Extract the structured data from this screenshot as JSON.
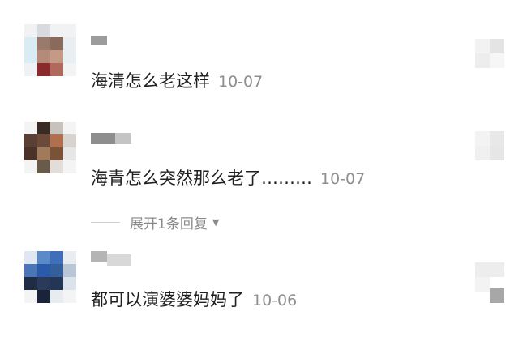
{
  "comments": [
    {
      "username": "",
      "text": "海清怎么老这样",
      "date": "10-07"
    },
    {
      "username": "",
      "text": "海青怎么突然那么老了………",
      "date": "10-07"
    },
    {
      "username": "",
      "text": "都可以演婆婆妈妈了",
      "date": "10-06"
    }
  ],
  "replies": {
    "expand_label": "展开1条回复"
  },
  "icons": {
    "chevron": "chevron-down-icon",
    "like": "like-icon",
    "avatar": "avatar"
  },
  "colors": {
    "text": "#1f1f1f",
    "date": "#8e8e8e",
    "muted": "#8a8a8a",
    "divider": "#cfcfcf"
  }
}
